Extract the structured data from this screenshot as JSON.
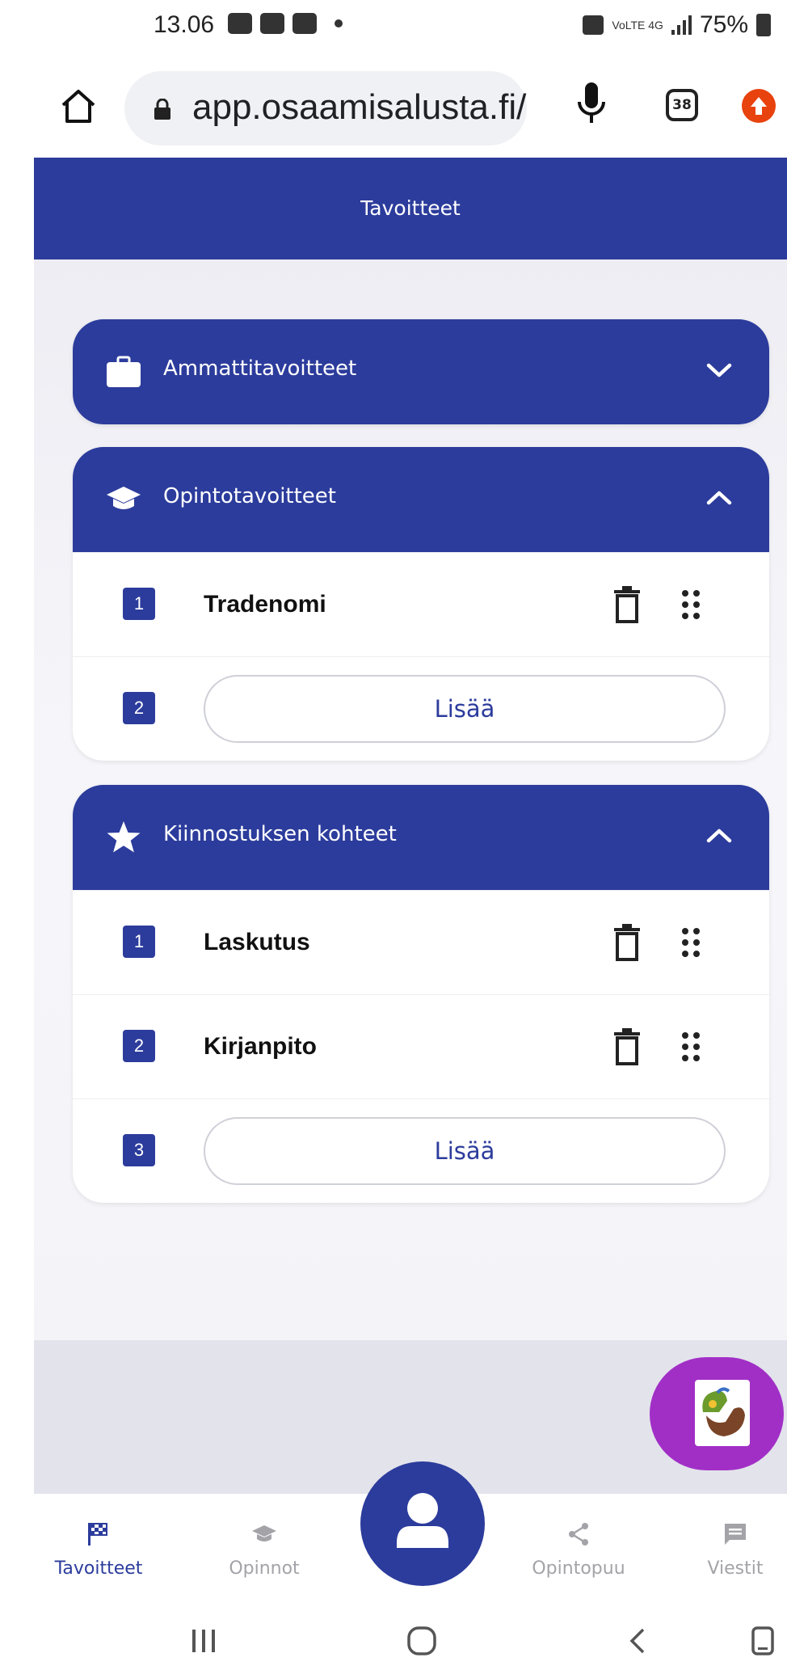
{
  "status_bar": {
    "time": "13.06",
    "battery": "75%",
    "network": "VoLTE 4G"
  },
  "browser": {
    "url": "app.osaamisalusta.fi/",
    "tabs_count": "38"
  },
  "header": {
    "title": "Tavoitteet"
  },
  "sections": [
    {
      "title": "Ammattitavoitteet",
      "icon": "briefcase-icon",
      "expanded": false,
      "items": []
    },
    {
      "title": "Opintotavoitteet",
      "icon": "graduation-cap-icon",
      "expanded": true,
      "items": [
        {
          "number": "1",
          "text": "Tradenomi"
        }
      ],
      "add": {
        "number": "2",
        "label": "Lisää"
      }
    },
    {
      "title": "Kiinnostuksen kohteet",
      "icon": "star-icon",
      "expanded": true,
      "items": [
        {
          "number": "1",
          "text": "Laskutus"
        },
        {
          "number": "2",
          "text": "Kirjanpito"
        }
      ],
      "add": {
        "number": "3",
        "label": "Lisää"
      }
    }
  ],
  "bottom_nav": [
    {
      "label": "Tavoitteet",
      "icon": "flag-icon",
      "active": true
    },
    {
      "label": "Opinnot",
      "icon": "graduation-cap-icon",
      "active": false
    },
    {
      "label": "Opintopuu",
      "icon": "share-icon",
      "active": false
    },
    {
      "label": "Viestit",
      "icon": "message-icon",
      "active": false
    }
  ],
  "colors": {
    "primary": "#2c3c9c",
    "avatar_bg": "#a12fc6",
    "inactive": "#a3a3a8"
  }
}
